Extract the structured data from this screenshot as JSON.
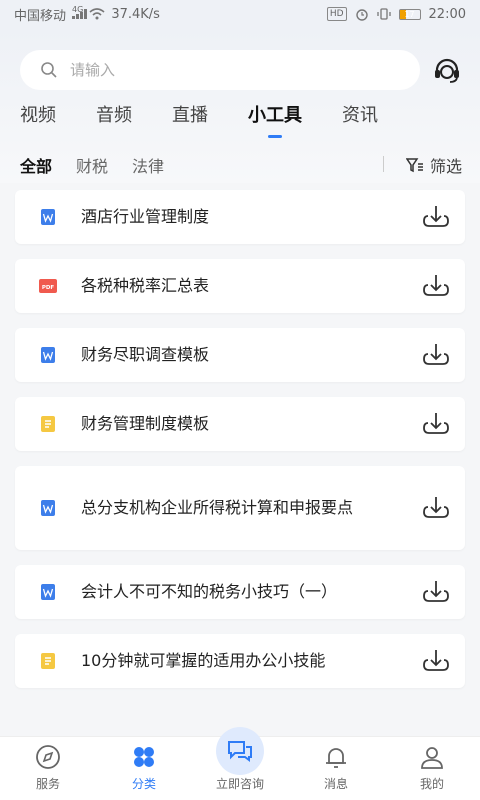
{
  "status_bar": {
    "carrier": "中国移动",
    "network": "4G",
    "speed": "37.4K/s",
    "hd": "HD",
    "battery": "17",
    "time": "22:00"
  },
  "search": {
    "placeholder": "请输入"
  },
  "tabs": [
    {
      "label": "视频"
    },
    {
      "label": "音频"
    },
    {
      "label": "直播"
    },
    {
      "label": "小工具"
    },
    {
      "label": "资讯"
    }
  ],
  "active_tab": "小工具",
  "filters": {
    "chips": [
      {
        "label": "全部"
      },
      {
        "label": "财税"
      },
      {
        "label": "法律"
      }
    ],
    "filter_label": "筛选"
  },
  "colors": {
    "accent": "#2f7cf6",
    "word": "#3d7eea",
    "pdf": "#f05a4e",
    "note": "#f5c842"
  },
  "files": [
    {
      "title": "酒店行业管理制度",
      "type": "word",
      "icon": "word-file-icon"
    },
    {
      "title": "各税种税率汇总表",
      "type": "pdf",
      "icon": "pdf-file-icon"
    },
    {
      "title": "财务尽职调查模板",
      "type": "word",
      "icon": "word-file-icon"
    },
    {
      "title": "财务管理制度模板",
      "type": "note",
      "icon": "note-file-icon"
    },
    {
      "title": "总分支机构企业所得税计算和申报要点",
      "type": "word",
      "icon": "word-file-icon"
    },
    {
      "title": "会计人不可不知的税务小技巧（一）",
      "type": "word",
      "icon": "word-file-icon"
    },
    {
      "title": "10分钟就可掌握的适用办公小技能",
      "type": "note",
      "icon": "note-file-icon"
    }
  ],
  "bottom_nav": [
    {
      "label": "服务",
      "icon": "compass-icon"
    },
    {
      "label": "分类",
      "icon": "category-icon"
    },
    {
      "label": "立即咨询",
      "icon": "chat-icon"
    },
    {
      "label": "消息",
      "icon": "bell-icon"
    },
    {
      "label": "我的",
      "icon": "user-icon"
    }
  ]
}
